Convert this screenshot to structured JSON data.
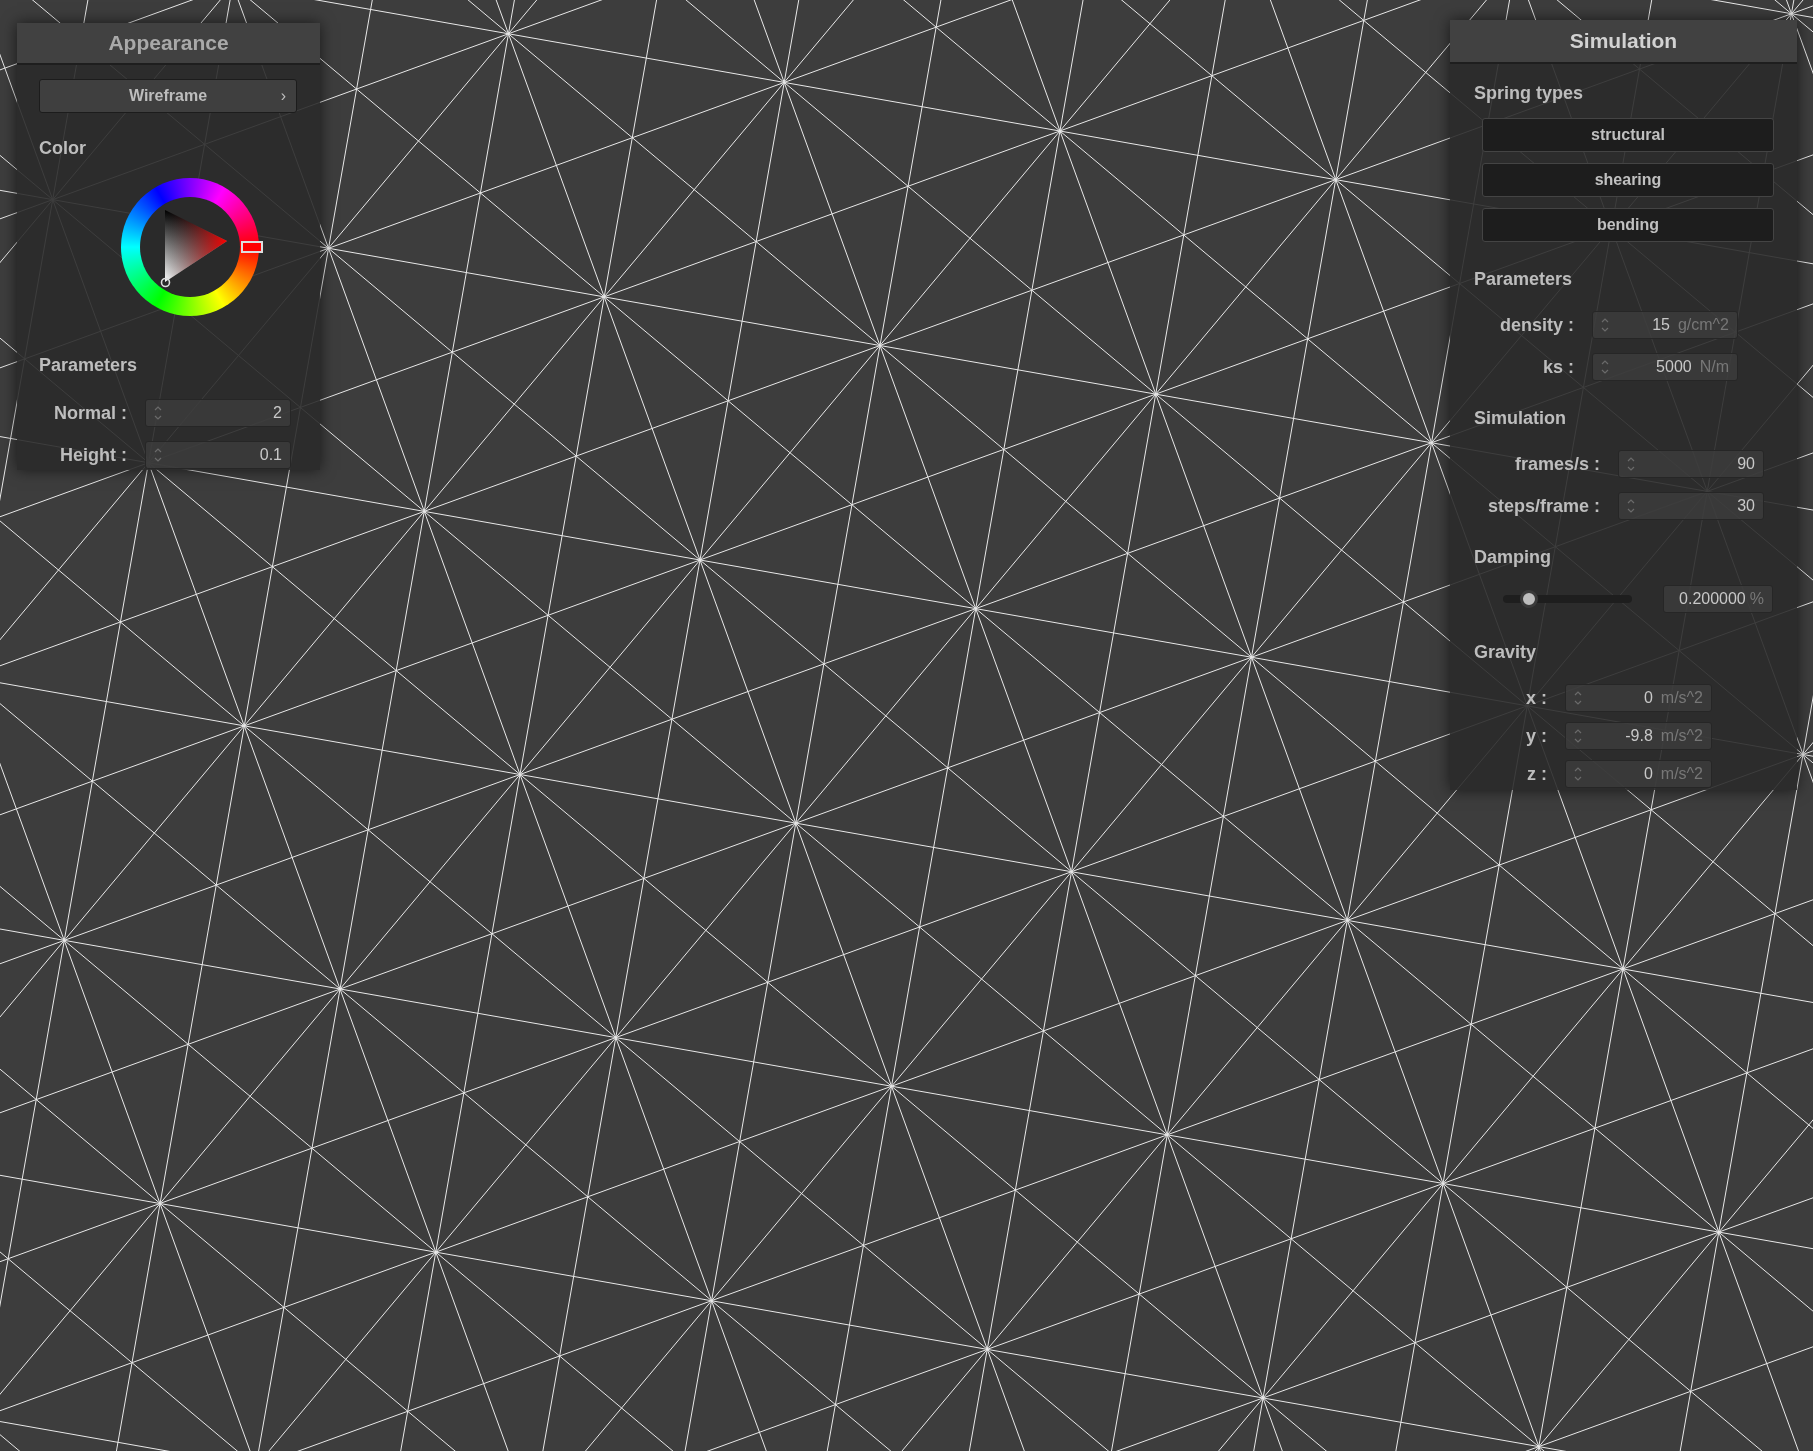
{
  "appearance_panel": {
    "title": "Appearance",
    "mode_button": {
      "label": "Wireframe",
      "chevron": "›"
    },
    "color_label": "Color",
    "color_picker": {
      "color": "#ff0000"
    },
    "parameters_label": "Parameters",
    "fields": [
      {
        "label": "Normal :",
        "value": "2"
      },
      {
        "label": "Height :",
        "value": "0.1"
      }
    ]
  },
  "simulation_panel": {
    "title": "Simulation",
    "spring_types_label": "Spring types",
    "spring_buttons": [
      {
        "label": "structural"
      },
      {
        "label": "shearing"
      },
      {
        "label": "bending"
      }
    ],
    "parameters_label": "Parameters",
    "parameters": [
      {
        "label": "density :",
        "value": "15",
        "unit": "g/cm^2"
      },
      {
        "label": "ks :",
        "value": "5000",
        "unit": "N/m"
      }
    ],
    "simulation_label": "Simulation",
    "simulation": [
      {
        "label": "frames/s :",
        "value": "90"
      },
      {
        "label": "steps/frame :",
        "value": "30"
      }
    ],
    "damping_label": "Damping",
    "damping": {
      "level": 0.2,
      "value": "0.200000",
      "unit": "%"
    },
    "gravity_label": "Gravity",
    "gravity": [
      {
        "label": "x :",
        "value": "0",
        "unit": "m/s^2"
      },
      {
        "label": "y :",
        "value": "-9.8",
        "unit": "m/s^2"
      },
      {
        "label": "z :",
        "value": "0",
        "unit": "m/s^2"
      }
    ]
  }
}
